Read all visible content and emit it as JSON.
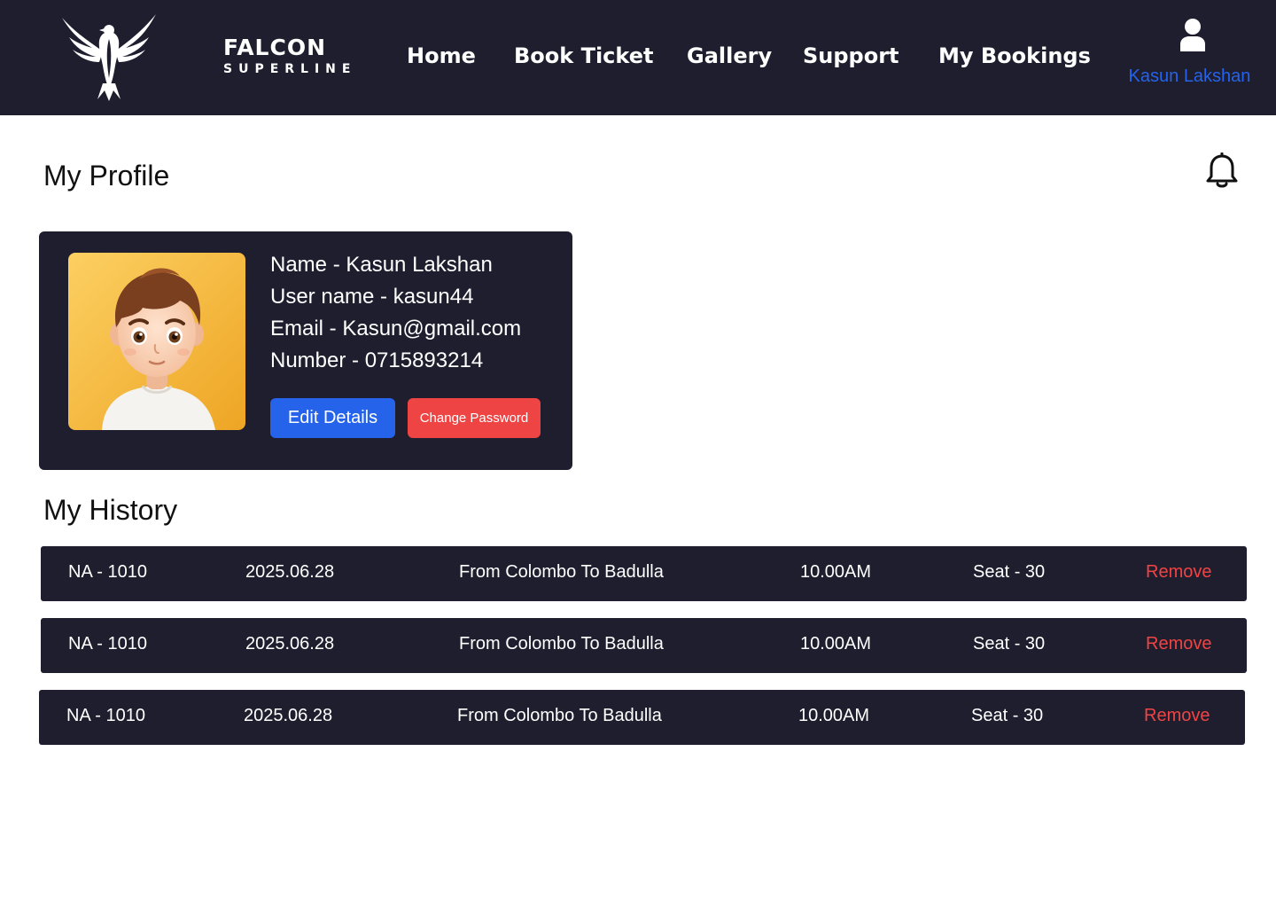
{
  "brand": {
    "name_line1": "FALCON",
    "name_line2": "SUPERLINE",
    "logo_icon": "falcon-emblem-icon"
  },
  "nav": {
    "items": [
      {
        "label": "Home"
      },
      {
        "label": "Book Ticket"
      },
      {
        "label": "Gallery"
      },
      {
        "label": "Support"
      },
      {
        "label": "My Bookings"
      }
    ]
  },
  "user": {
    "icon": "user-icon",
    "name": "Kasun Lakshan"
  },
  "page": {
    "title": "My Profile",
    "notification_icon": "bell-icon"
  },
  "profile": {
    "name": "Name - Kasun Lakshan",
    "username": "User name - kasun44",
    "email": "Email - Kasun@gmail.com",
    "number": "Number - 0715893214",
    "edit_label": "Edit Details",
    "change_password_label": "Change Password"
  },
  "history": {
    "title": "My History",
    "rows": [
      {
        "bus": "NA - 1010",
        "date": "2025.06.28",
        "route": "From Colombo To Badulla",
        "time": "10.00AM",
        "seat": "Seat - 30",
        "action": "Remove"
      },
      {
        "bus": "NA - 1010",
        "date": "2025.06.28",
        "route": "From Colombo To Badulla",
        "time": "10.00AM",
        "seat": "Seat - 30",
        "action": "Remove"
      },
      {
        "bus": "NA - 1010",
        "date": "2025.06.28",
        "route": "From Colombo To Badulla",
        "time": "10.00AM",
        "seat": "Seat - 30",
        "action": "Remove"
      }
    ]
  },
  "colors": {
    "navbar_bg": "#1f1e2e",
    "primary": "#2563eb",
    "danger": "#ef4444",
    "text_on_dark": "#ffffff"
  }
}
